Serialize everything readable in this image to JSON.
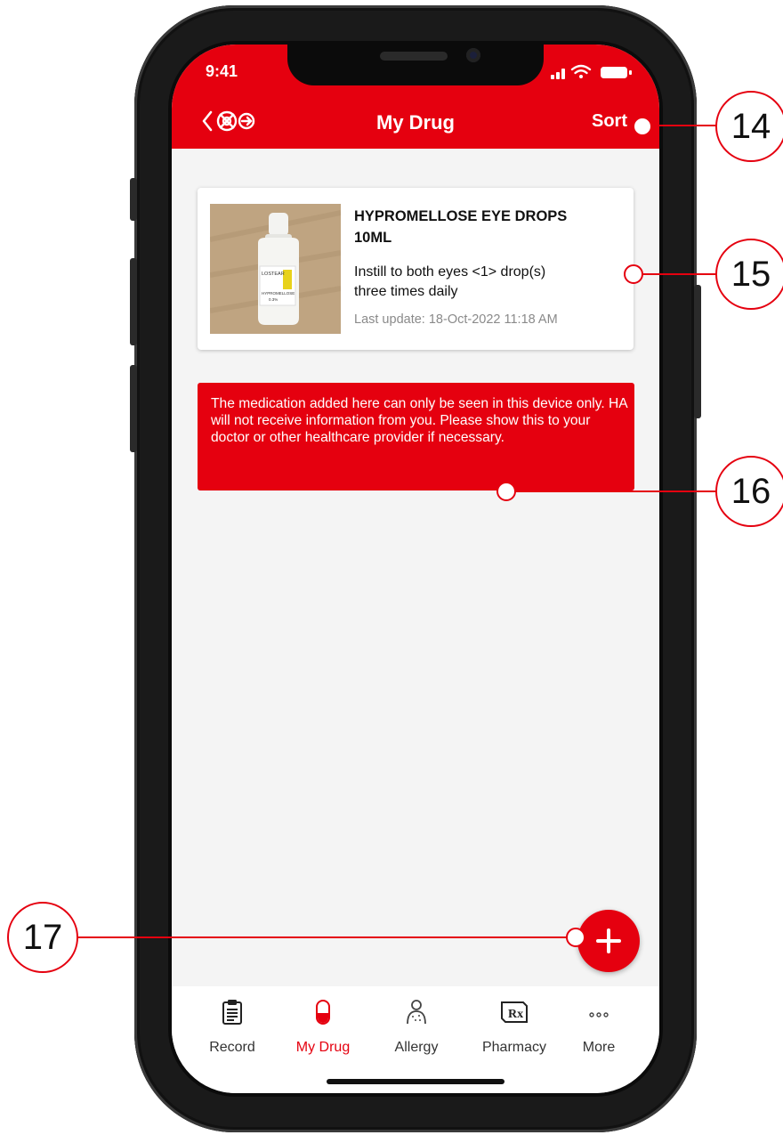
{
  "status_bar": {
    "time": "9:41"
  },
  "header": {
    "title": "My Drug",
    "sort_label": "Sort"
  },
  "drug_card": {
    "name_line1": "HYPROMELLOSE EYE DROPS",
    "name_line2": "10ML",
    "instruction_line1": "Instill to both eyes <1> drop(s)",
    "instruction_line2": "three times daily",
    "last_update_label": "Last update:",
    "last_update_value": "18-Oct-2022 11:18 AM",
    "photo_label_1": "LOSTEAR",
    "photo_label_2": "HYPROMELLOSE",
    "photo_label_3": "0.3%"
  },
  "notice": {
    "text": "The medication added here can only be seen in this device only. HA will not receive information from you. Please show this to your doctor or other healthcare provider if necessary."
  },
  "fab": {
    "icon": "plus-icon"
  },
  "tabbar": {
    "items": [
      {
        "label": "Record",
        "icon": "clipboard-icon"
      },
      {
        "label": "My Drug",
        "icon": "capsule-icon",
        "active": true
      },
      {
        "label": "Allergy",
        "icon": "body-allergy-icon"
      },
      {
        "label": "Pharmacy",
        "icon": "prescription-rx-icon"
      },
      {
        "label": "More",
        "icon": "more-dots-icon"
      }
    ]
  },
  "callouts": [
    "14",
    "15",
    "16",
    "17"
  ],
  "colors": {
    "brand_red": "#e5000f",
    "background": "#f4f4f4"
  }
}
